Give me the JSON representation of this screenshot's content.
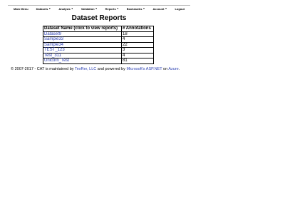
{
  "nav": {
    "items": [
      {
        "label": "Main Menu",
        "dropdown": false
      },
      {
        "label": "Datasets",
        "dropdown": true
      },
      {
        "label": "Analysis",
        "dropdown": true
      },
      {
        "label": "Validation",
        "dropdown": true
      },
      {
        "label": "Reports",
        "dropdown": true
      },
      {
        "label": "Bookmarks",
        "dropdown": true
      },
      {
        "label": "Account",
        "dropdown": true
      },
      {
        "label": "Logout",
        "dropdown": false
      }
    ],
    "caret": "▼"
  },
  "page": {
    "title": "Dataset Reports"
  },
  "table": {
    "headers": [
      "Dataset Name (click to view reports)",
      "# Annotations"
    ],
    "rows": [
      {
        "name": "Dataset9",
        "annotations": "18"
      },
      {
        "name": "Sample33",
        "annotations": "4"
      },
      {
        "name": "Sample34",
        "annotations": "22"
      },
      {
        "name": "TEST_123",
        "annotations": "3"
      },
      {
        "name": "Test_311",
        "annotations": "4"
      },
      {
        "name": "Unicorn_Test",
        "annotations": "81"
      }
    ]
  },
  "footer": {
    "prefix": "© 2007-2017 - CAT is maintained by ",
    "link1": "TexRer, LLC",
    "middle": " and powered by ",
    "link2": "Microsoft's ASP.NET",
    "mid2": " on ",
    "link3": "Azure",
    "suffix": "."
  }
}
